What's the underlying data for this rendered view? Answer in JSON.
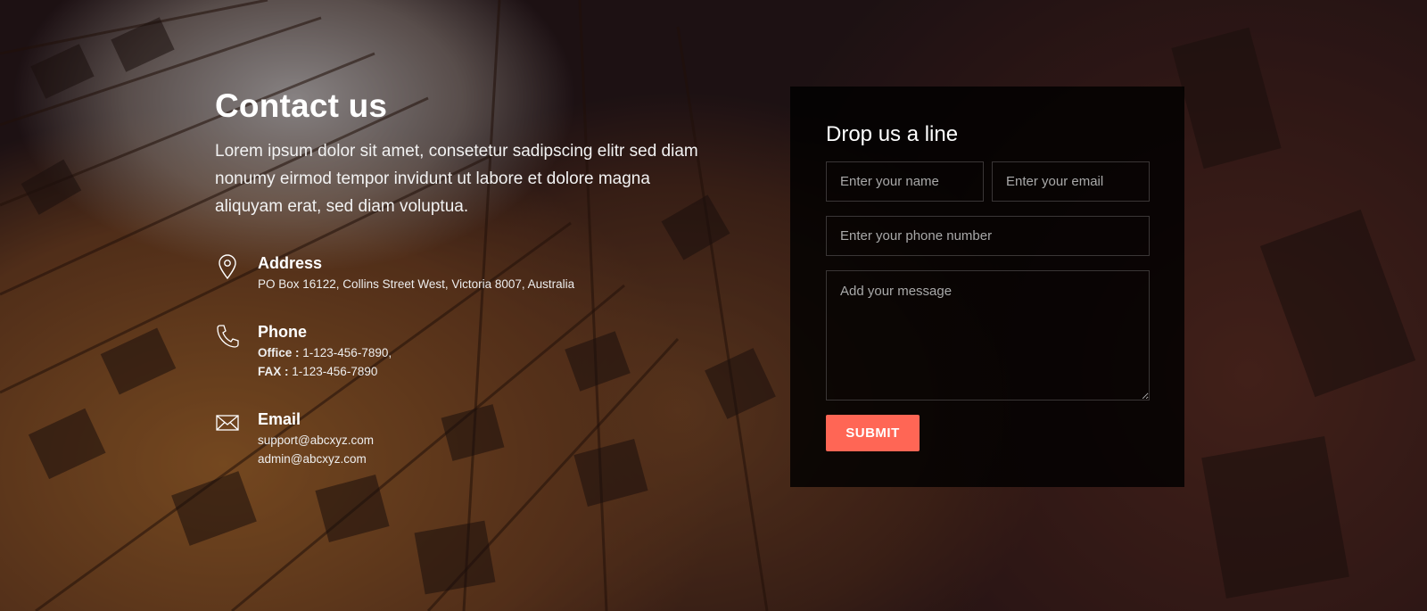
{
  "contact": {
    "title": "Contact us",
    "lead": "Lorem ipsum dolor sit amet, consetetur sadipscing elitr sed diam nonumy eirmod tempor invidunt ut labore et dolore magna aliquyam erat, sed diam voluptua.",
    "address": {
      "icon": "map-pin-icon",
      "heading": "Address",
      "text": "PO Box 16122, Collins Street West, Victoria 8007, Australia"
    },
    "phone": {
      "icon": "phone-icon",
      "heading": "Phone",
      "office_label": "Office :",
      "office_value": " 1-123-456-7890,",
      "fax_label": "FAX :",
      "fax_value": " 1-123-456-7890"
    },
    "email": {
      "icon": "envelope-icon",
      "heading": "Email",
      "lines": [
        "support@abcxyz.com",
        "admin@abcxyz.com"
      ]
    }
  },
  "form": {
    "title": "Drop us a line",
    "name_placeholder": "Enter your name",
    "email_placeholder": "Enter your email",
    "phone_placeholder": "Enter your phone number",
    "message_placeholder": "Add your message",
    "submit_label": "SUBMIT"
  },
  "colors": {
    "accent": "#ff6655",
    "form_bg": "#000000"
  }
}
